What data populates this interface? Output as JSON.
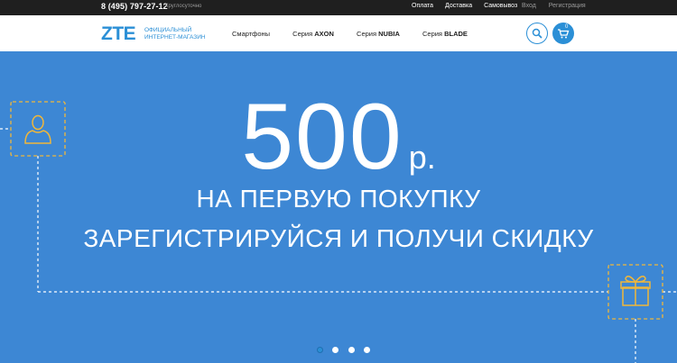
{
  "topbar": {
    "phone": "8 (495) 797-27-12",
    "hours": "Круглосуточно",
    "links": [
      "Оплата",
      "Доставка",
      "Самовывоз"
    ],
    "auth": [
      "Вход",
      "Регистрация"
    ]
  },
  "header": {
    "logo": "ZTE",
    "tagline": "ОФИЦИАЛЬНЫЙ ИНТЕРНЕТ-МАГАЗИН",
    "nav": [
      {
        "prefix": "Смартфоны",
        "bold": ""
      },
      {
        "prefix": "Серия",
        "bold": "AXON"
      },
      {
        "prefix": "Серия",
        "bold": "NUBIA"
      },
      {
        "prefix": "Серия",
        "bold": "BLADE"
      }
    ],
    "cart_count": "0",
    "icons": {
      "search": "search-icon",
      "cart": "cart-icon"
    }
  },
  "hero": {
    "amount": "500",
    "currency": "р.",
    "line1": "НА ПЕРВУЮ ПОКУПКУ",
    "line2": "ЗАРЕГИСТРИРУЙСЯ И ПОЛУЧИ СКИДКУ",
    "slides_total": 4,
    "active_slide": 1
  },
  "colors": {
    "accent": "#2b8fd6",
    "hero_bg": "#3d87d4",
    "dash": "#f0b73a"
  }
}
